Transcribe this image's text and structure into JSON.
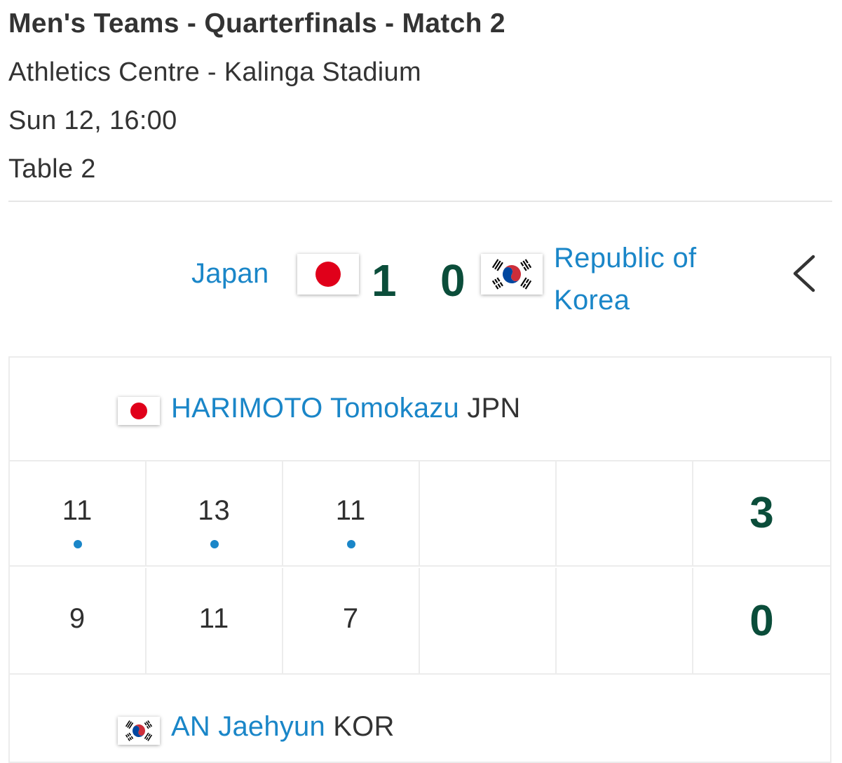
{
  "header": {
    "title": "Men's Teams - Quarterfinals - Match 2",
    "venue": "Athletics Centre - Kalinga Stadium",
    "datetime": "Sun 12, 16:00",
    "table": "Table 2"
  },
  "teams": {
    "home": {
      "name": "Japan",
      "score": "1",
      "flag": "japan-flag"
    },
    "away": {
      "name": "Republic of Korea",
      "score": "0",
      "flag": "korea-flag"
    }
  },
  "match": {
    "home_player": {
      "name": "HARIMOTO Tomokazu",
      "code": "JPN",
      "flag": "japan-flag"
    },
    "away_player": {
      "name": "AN Jaehyun",
      "code": "KOR",
      "flag": "korea-flag"
    },
    "home_games": [
      "11",
      "13",
      "11",
      "",
      ""
    ],
    "away_games": [
      "9",
      "11",
      "7",
      "",
      ""
    ],
    "home_game_won": [
      true,
      true,
      true,
      false,
      false
    ],
    "home_total": "3",
    "away_total": "0"
  },
  "colors": {
    "link": "#1a86c8",
    "score": "#0b4d3a",
    "text": "#333333",
    "border": "#ececec"
  },
  "icons": {
    "back": "chevron-left-icon",
    "game_winner": "win-dot-icon"
  }
}
